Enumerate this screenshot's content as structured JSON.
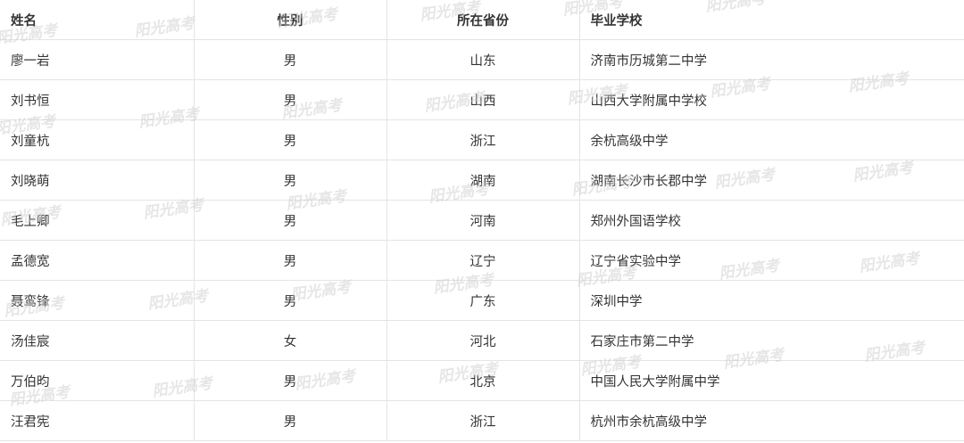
{
  "table": {
    "headers": [
      "姓名",
      "性别",
      "所在省份",
      "毕业学校"
    ],
    "rows": [
      [
        "廖一岩",
        "男",
        "山东",
        "济南市历城第二中学"
      ],
      [
        "刘书恒",
        "男",
        "山西",
        "山西大学附属中学校"
      ],
      [
        "刘童杭",
        "男",
        "浙江",
        "余杭高级中学"
      ],
      [
        "刘晓萌",
        "男",
        "湖南",
        "湖南长沙市长郡中学"
      ],
      [
        "毛上卿",
        "男",
        "河南",
        "郑州外国语学校"
      ],
      [
        "孟德宽",
        "男",
        "辽宁",
        "辽宁省实验中学"
      ],
      [
        "聂鸾锋",
        "男",
        "广东",
        "深圳中学"
      ],
      [
        "汤佳宸",
        "女",
        "河北",
        "石家庄市第二中学"
      ],
      [
        "万伯昀",
        "男",
        "北京",
        "中国人民大学附属中学"
      ],
      [
        "汪君宪",
        "男",
        "浙江",
        "杭州市余杭高级中学"
      ]
    ]
  },
  "watermark": {
    "text": "阳光高考",
    "color": "#c8c8c8"
  }
}
